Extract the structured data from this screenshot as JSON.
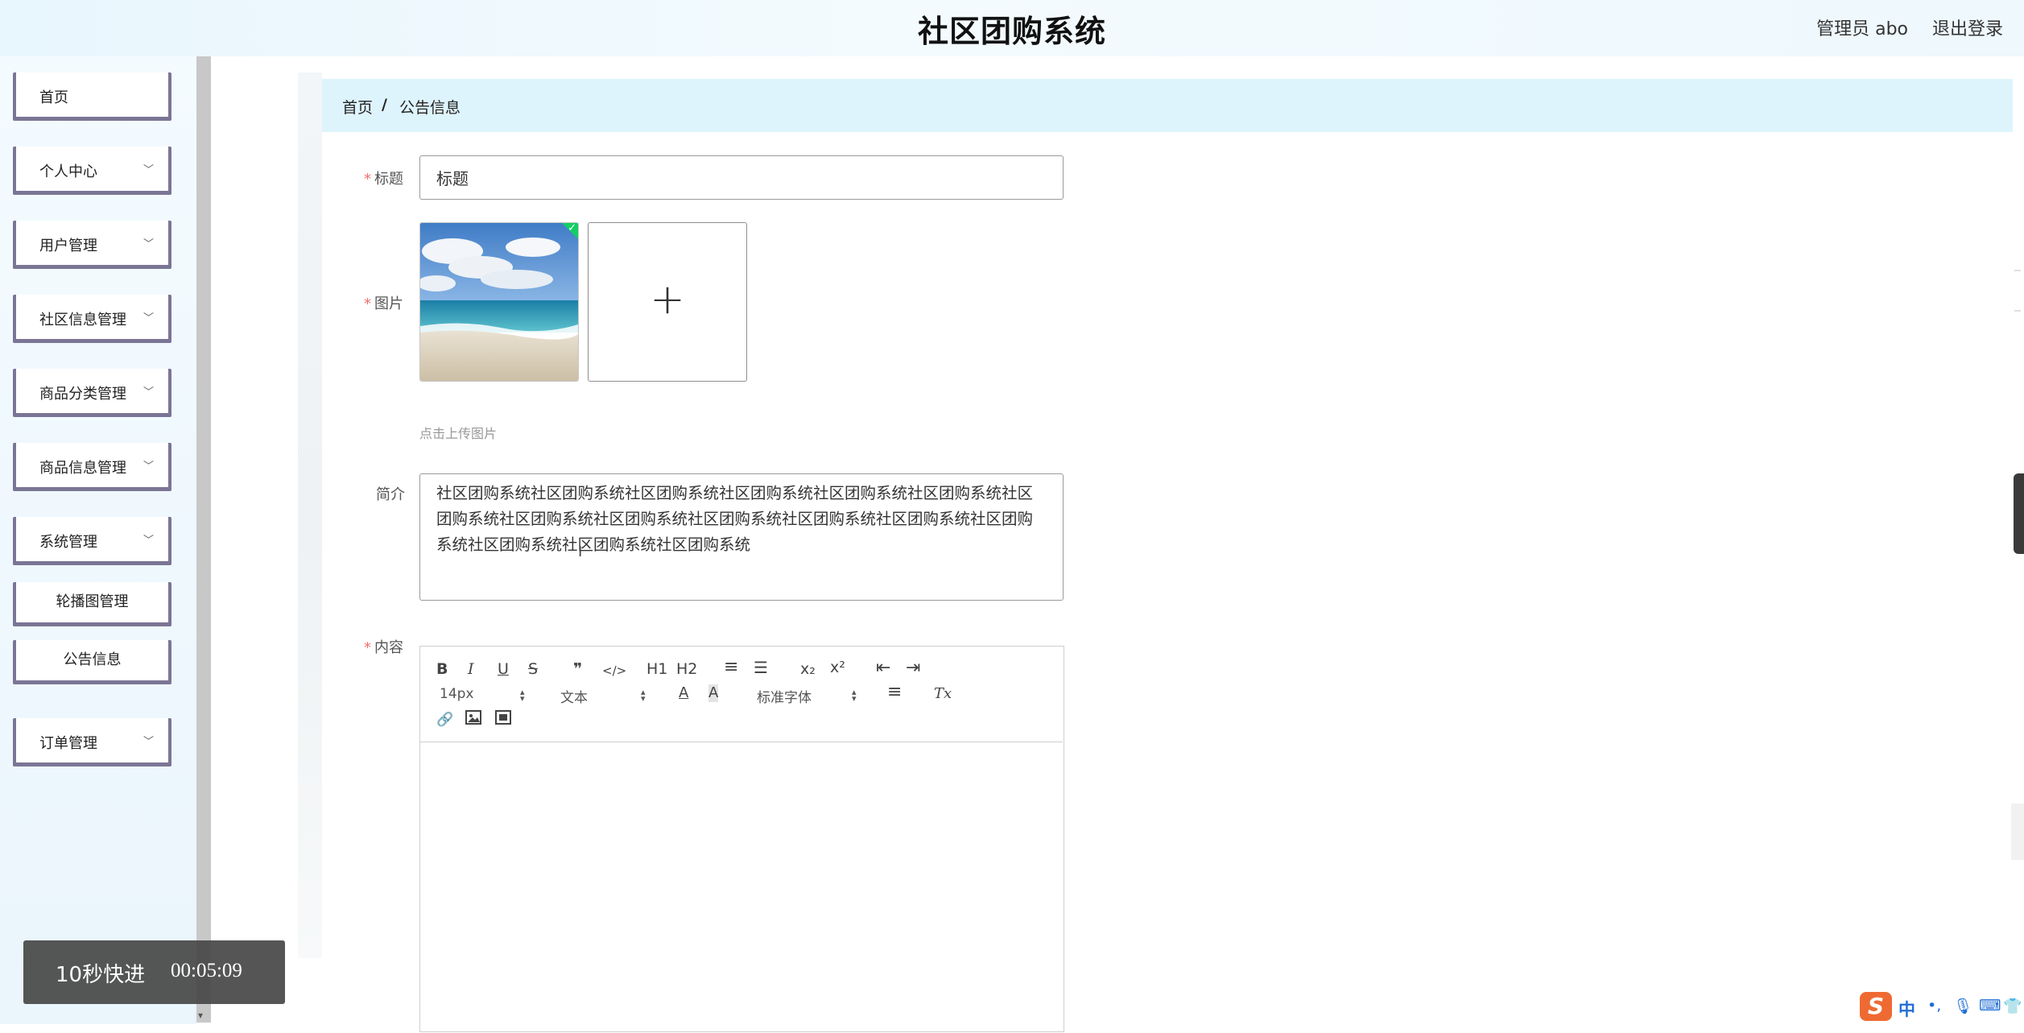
{
  "header": {
    "title": "社区团购系统",
    "admin": "管理员 abo",
    "logout": "退出登录"
  },
  "sidebar": {
    "items": [
      {
        "label": "首页",
        "has_children": false
      },
      {
        "label": "个人中心",
        "has_children": true
      },
      {
        "label": "用户管理",
        "has_children": true
      },
      {
        "label": "社区信息管理",
        "has_children": true
      },
      {
        "label": "商品分类管理",
        "has_children": true
      },
      {
        "label": "商品信息管理",
        "has_children": true
      },
      {
        "label": "系统管理",
        "has_children": true,
        "expanded": true
      },
      {
        "label": "订单管理",
        "has_children": true
      }
    ],
    "sub_items": [
      {
        "label": "轮播图管理"
      },
      {
        "label": "公告信息",
        "active": true
      }
    ]
  },
  "breadcrumb": {
    "home": "首页",
    "separator": "/",
    "current": "公告信息"
  },
  "form": {
    "required_mark": "*",
    "title_label": "标题",
    "title_value": "标题",
    "image_label": "图片",
    "upload_tip": "点击上传图片",
    "intro_label": "简介",
    "intro_value": "社区团购系统社区团购系统社区团购系统社区团购系统社区团购系统社区团购系统社区团购系统社区团购系统社区团购系统社区团购系统社区团购系统社区团购系统社区团购系统社区团购系统社区团购系统社区团购系统",
    "content_label": "内容"
  },
  "editor": {
    "font_size": "14px",
    "header_select": "文本",
    "font_family": "标准字体",
    "buttons": {
      "bold": "B",
      "italic": "I",
      "underline": "U",
      "strike": "S",
      "quote": "❞",
      "code": "</>",
      "h1": "H1",
      "h2": "H2",
      "ol": "≡",
      "ul": "☰",
      "sub": "x₂",
      "sup": "x²",
      "outdent": "⇤",
      "indent": "⇥",
      "color": "A",
      "background": "A",
      "align": "≡",
      "clean": "Tx"
    }
  },
  "video_overlay": {
    "skip": "10秒快进",
    "time": "00:05:09"
  },
  "ime": {
    "logo": "S",
    "lang": "中"
  },
  "colors": {
    "breadcrumb_bg": "#def4fd",
    "sidebar_border": "#7b7595",
    "required": "#f56c6c",
    "upload_check": "#13ce66"
  }
}
